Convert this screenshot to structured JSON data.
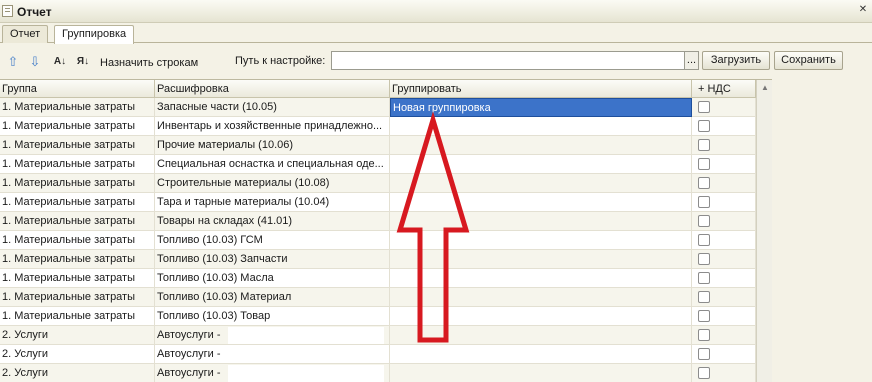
{
  "window": {
    "title": "Отчет",
    "icon": "document-icon",
    "close_label": "✕"
  },
  "tabs": [
    {
      "label": "Отчет",
      "active": false
    },
    {
      "label": "Группировка",
      "active": true
    }
  ],
  "toolbar": {
    "icons": [
      "arrow-up-icon",
      "arrow-down-icon",
      "sort-asc-icon",
      "sort-desc-icon"
    ],
    "assign_rows_label": "Назначить строкам",
    "path_label": "Путь к настройке:",
    "path_value": "",
    "browse_label": "...",
    "load_label": "Загрузить",
    "save_label": "Сохранить"
  },
  "grid": {
    "columns": [
      "Группа",
      "Расшифровка",
      "Группировать",
      "+ НДС"
    ],
    "rows": [
      {
        "group": "1. Материальные затраты",
        "detail": "Запасные части (10.05)",
        "grouping": "Новая группировка",
        "vat": false
      },
      {
        "group": "1. Материальные затраты",
        "detail": "Инвентарь и хозяйственные принадлежно...",
        "grouping": "",
        "vat": false
      },
      {
        "group": "1. Материальные затраты",
        "detail": "Прочие материалы (10.06)",
        "grouping": "",
        "vat": false
      },
      {
        "group": "1. Материальные затраты",
        "detail": "Специальная оснастка и специальная оде...",
        "grouping": "",
        "vat": false
      },
      {
        "group": "1. Материальные затраты",
        "detail": "Строительные материалы (10.08)",
        "grouping": "",
        "vat": false
      },
      {
        "group": "1. Материальные затраты",
        "detail": "Тара и тарные материалы (10.04)",
        "grouping": "",
        "vat": false
      },
      {
        "group": "1. Материальные затраты",
        "detail": "Товары на складах (41.01)",
        "grouping": "",
        "vat": false
      },
      {
        "group": "1. Материальные затраты",
        "detail": "Топливо (10.03) ГСМ",
        "grouping": "",
        "vat": false
      },
      {
        "group": "1. Материальные затраты",
        "detail": "Топливо (10.03) Запчасти",
        "grouping": "",
        "vat": false
      },
      {
        "group": "1. Материальные затраты",
        "detail": "Топливо (10.03) Масла",
        "grouping": "",
        "vat": false
      },
      {
        "group": "1. Материальные затраты",
        "detail": "Топливо (10.03) Материал",
        "grouping": "",
        "vat": false
      },
      {
        "group": "1. Материальные затраты",
        "detail": "Топливо (10.03) Товар",
        "grouping": "",
        "vat": false
      },
      {
        "group": "2. Услуги",
        "detail": "Автоуслуги  -",
        "grouping": "",
        "vat": false
      },
      {
        "group": "2. Услуги",
        "detail": "Автоуслуги  -",
        "grouping": "",
        "vat": false
      },
      {
        "group": "2. Услуги",
        "detail": "Автоуслуги  -",
        "grouping": "",
        "vat": false
      }
    ]
  },
  "annotation": {
    "shape": "arrow-up",
    "color": "#d71920"
  },
  "colors": {
    "selection": "#3c73c9",
    "accent_arrow": "#d71920"
  }
}
